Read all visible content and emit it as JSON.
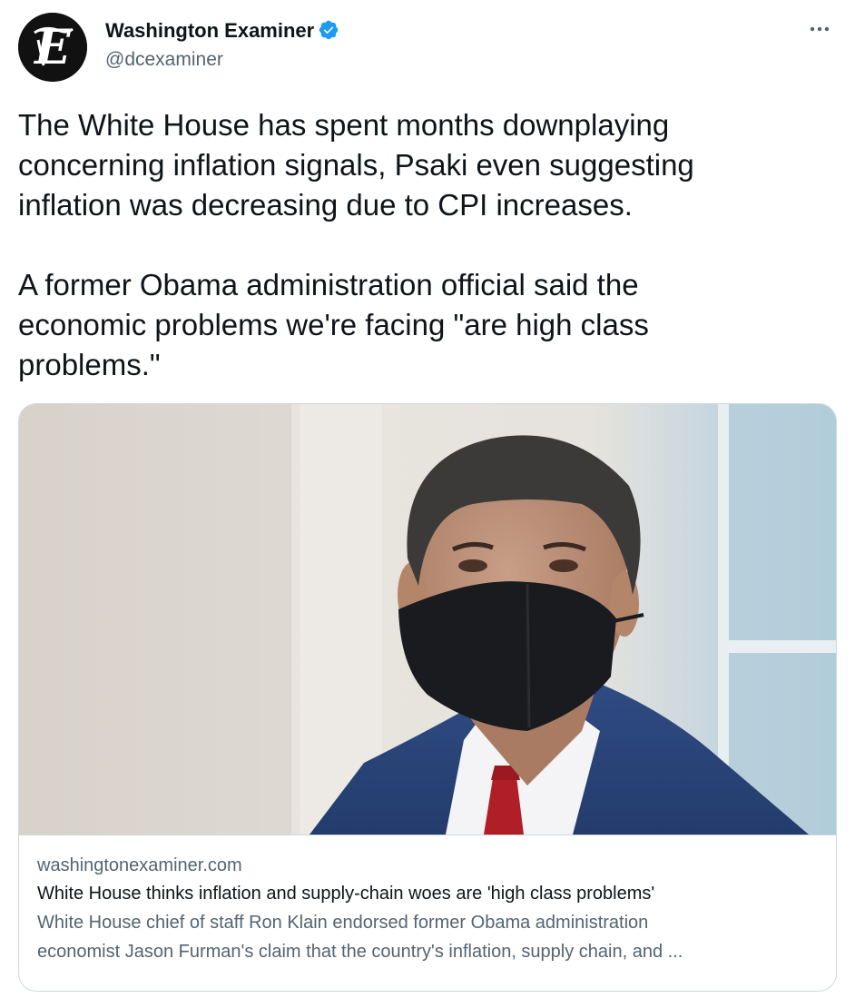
{
  "author": {
    "display_name": "Washington Examiner",
    "handle": "@dcexaminer",
    "verified": true,
    "avatar_icon": "washington-examiner-logo-icon"
  },
  "menu": {
    "icon": "more-options-icon",
    "label": "···"
  },
  "tweet": {
    "text": "The White House has spent months downplaying\nconcerning inflation signals, Psaki even suggesting\ninflation was decreasing due to CPI increases.\n\nA former Obama administration official said the\neconomic problems we're facing \"are high class\nproblems.\""
  },
  "link_card": {
    "image_icon": "article-photo",
    "domain": "washingtonexaminer.com",
    "title": "White House thinks inflation and supply-chain woes are 'high class problems'",
    "description_line1": "White House chief of staff Ron Klain endorsed former Obama administration",
    "description_line2": "economist Jason Furman's claim that the country's inflation, supply chain, and ..."
  },
  "colors": {
    "text_primary": "#0f1419",
    "text_secondary": "#536471",
    "verified_blue": "#1d9bf0",
    "border": "#cfd9de"
  }
}
